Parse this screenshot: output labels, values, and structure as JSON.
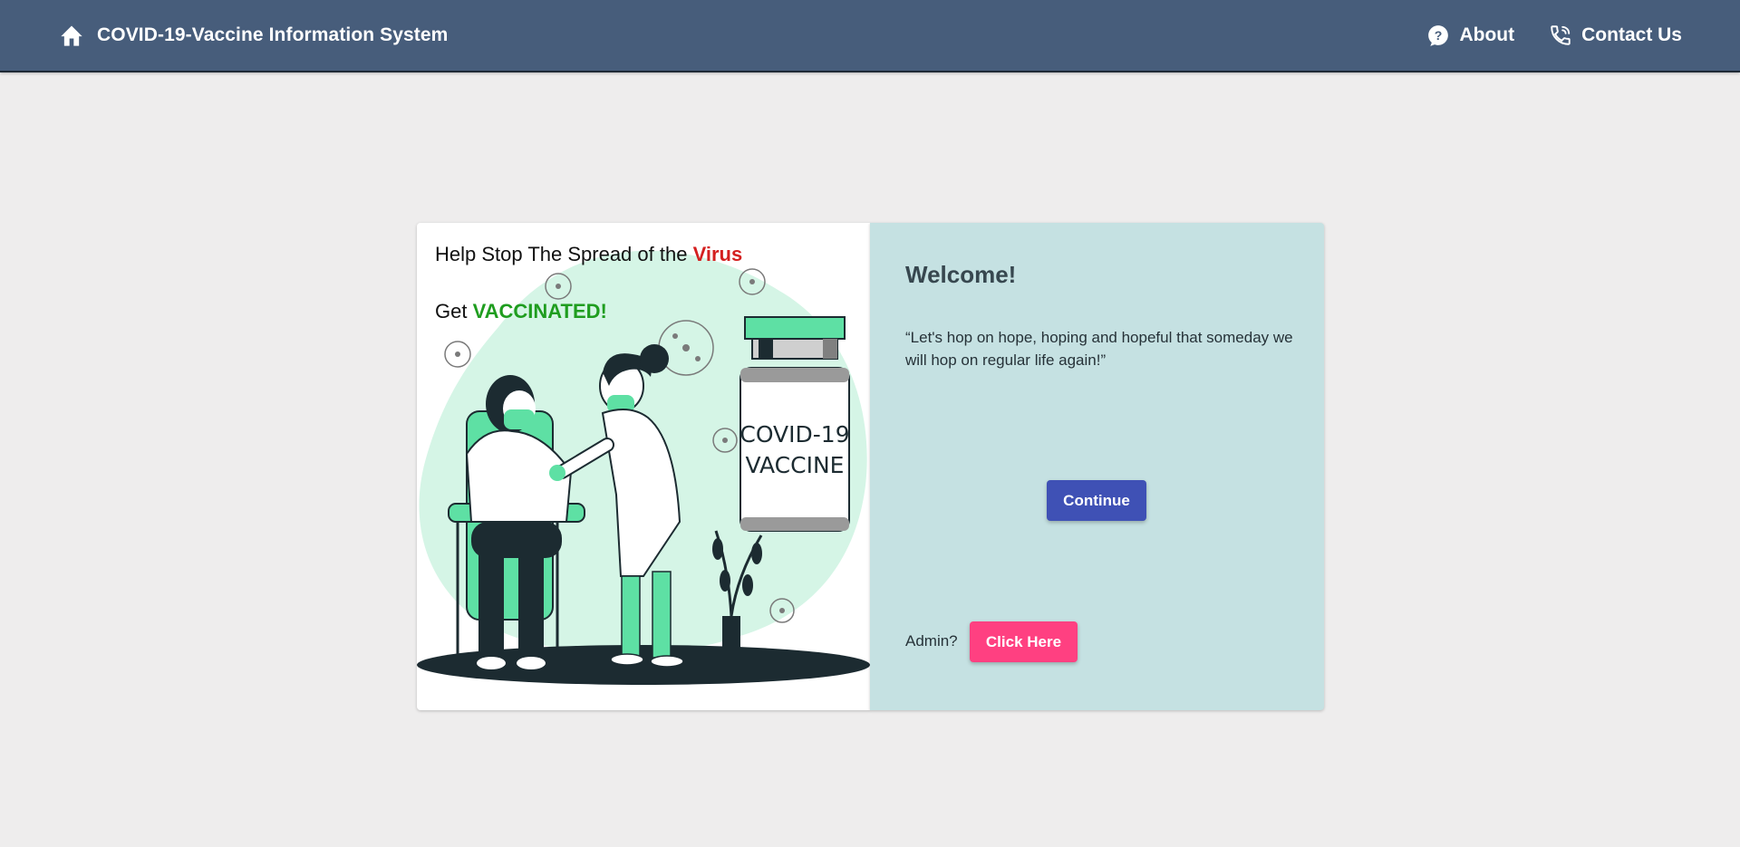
{
  "topbar": {
    "title": "COVID-19-Vaccine Information System",
    "home_icon": "home-icon",
    "nav": [
      {
        "label": "About",
        "icon": "help-circle-icon"
      },
      {
        "label": "Contact Us",
        "icon": "phone-icon"
      }
    ],
    "background": "#475d7b"
  },
  "left_panel": {
    "headline_1_prefix": "Help Stop The Spread of the ",
    "headline_1_highlight": "Virus",
    "headline_2_prefix": "Get ",
    "headline_2_highlight": "VACCINATED!",
    "illustration": {
      "vial_text_line1": "COVID-19",
      "vial_text_line2": "VACCINE"
    }
  },
  "right_panel": {
    "welcome": "Welcome!",
    "quote": "“Let's hop on hope, hoping and hopeful that someday we will hop on regular life again!”",
    "continue_label": "Continue",
    "admin_prompt": "Admin?",
    "admin_button_label": "Click Here",
    "background": "#c5e1e2"
  },
  "colors": {
    "continue_button": "#3f51b5",
    "admin_button": "#ff4081",
    "virus_highlight": "#d42020",
    "vaccinated_highlight": "#1f9d1f"
  }
}
